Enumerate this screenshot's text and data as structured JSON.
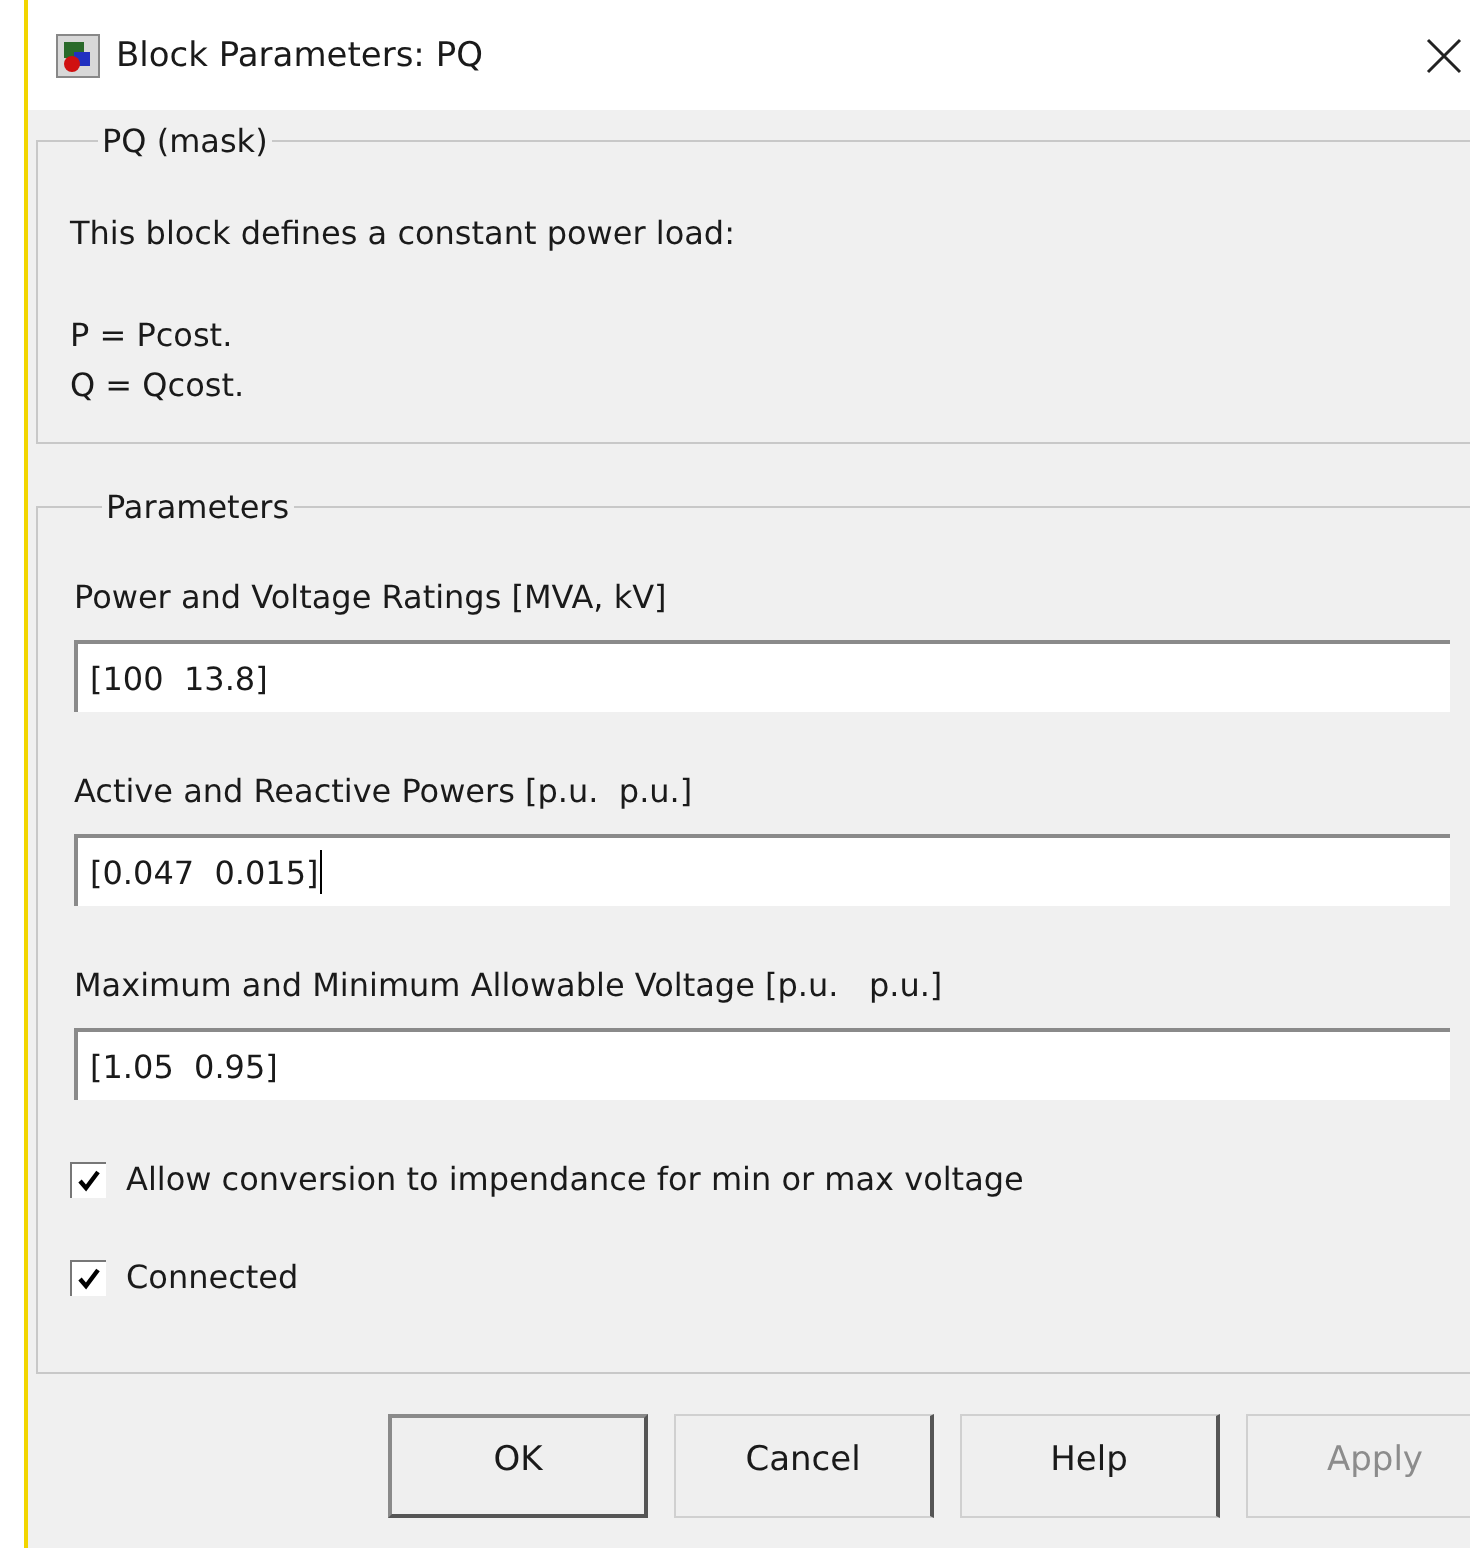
{
  "window": {
    "title": "Block Parameters: PQ"
  },
  "mask": {
    "title": "PQ (mask)",
    "intro": "This block defines a constant power load:",
    "formulas": [
      "P = Pcost.",
      "Q = Qcost."
    ]
  },
  "parameters": {
    "title": "Parameters",
    "fields": [
      {
        "label": "Power and Voltage Ratings [MVA, kV]",
        "value": "[100  13.8]",
        "focused": false
      },
      {
        "label": "Active and Reactive Powers [p.u.  p.u.]",
        "value": "[0.047  0.015]",
        "focused": true
      },
      {
        "label": "Maximum and Minimum Allowable Voltage [p.u.   p.u.]",
        "value": "[1.05  0.95]",
        "focused": false
      }
    ],
    "checkboxes": [
      {
        "label": "Allow conversion to impendance for min or max voltage",
        "checked": true
      },
      {
        "label": "Connected",
        "checked": true
      }
    ]
  },
  "buttons": [
    {
      "label": "OK",
      "default": true,
      "disabled": false
    },
    {
      "label": "Cancel",
      "default": false,
      "disabled": false
    },
    {
      "label": "Help",
      "default": false,
      "disabled": false
    },
    {
      "label": "Apply",
      "default": false,
      "disabled": true
    }
  ]
}
